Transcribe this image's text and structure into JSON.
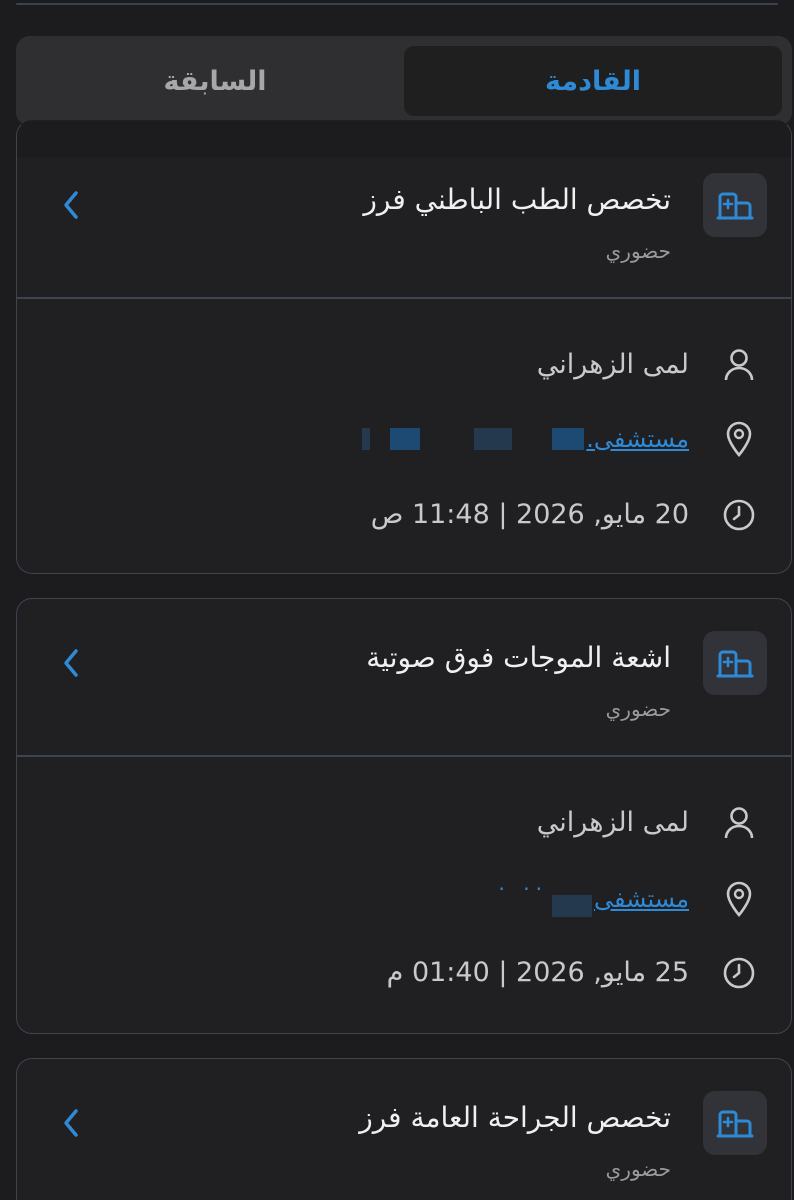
{
  "tabs": {
    "upcoming_label": "القادمة",
    "previous_label": "السابقة"
  },
  "appointments": [
    {
      "title": "تخصص الطب الباطني فرز",
      "visit_type": "حضوري",
      "doctor": "لمى الزهراني",
      "location": "مستشفى.",
      "datetime": "20 مايو, 2026 | 11:48 ص"
    },
    {
      "title": "اشعة الموجات فوق صوتية",
      "visit_type": "حضوري",
      "doctor": "لمى الزهراني",
      "location": "مستشفى",
      "datetime": "25 مايو, 2026 | 01:40 م"
    },
    {
      "title": "تخصص الجراحة العامة فرز",
      "visit_type": "حضوري"
    }
  ],
  "colors": {
    "accent": "#2f8ad6",
    "background": "#1c1c1e",
    "card_border": "#3d4452"
  },
  "icons": {
    "badge": "clinic-building-icon",
    "chevron": "chevron-left-icon",
    "doctor": "person-icon",
    "location": "location-pin-icon",
    "time": "clock-icon"
  }
}
